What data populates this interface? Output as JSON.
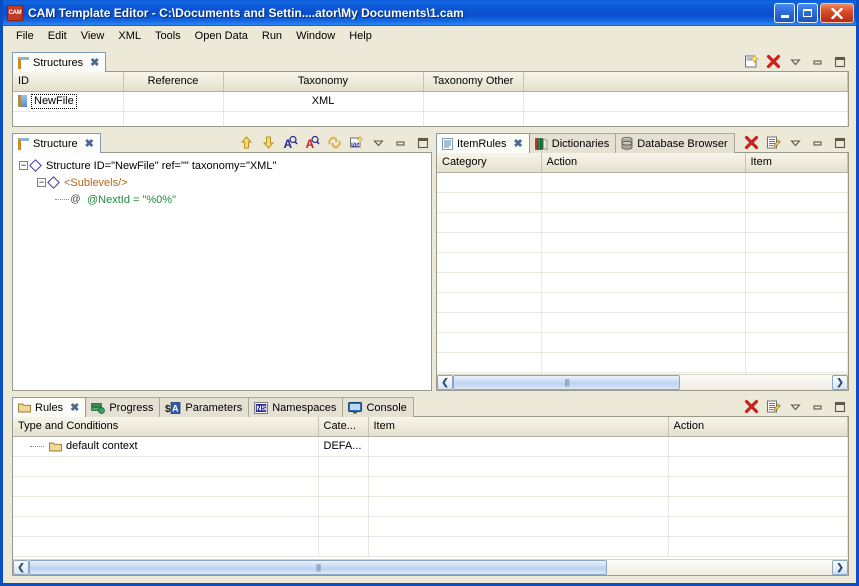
{
  "window": {
    "title": "CAM Template Editor - C:\\Documents and Settin....ator\\My Documents\\1.cam",
    "app_icon_label": "CAM",
    "minimize_label": "Minimize",
    "maximize_label": "Maximize",
    "close_label": "Close",
    "titlebar_color": "#0a50cf",
    "chrome_color": "#ece9d8"
  },
  "menubar": {
    "items": [
      {
        "label": "File"
      },
      {
        "label": "Edit"
      },
      {
        "label": "View"
      },
      {
        "label": "XML"
      },
      {
        "label": "Tools"
      },
      {
        "label": "Open Data"
      },
      {
        "label": "Run"
      },
      {
        "label": "Window"
      },
      {
        "label": "Help"
      }
    ]
  },
  "structures_view": {
    "tab": {
      "label": "Structures",
      "close_glyph": "✖",
      "icon": "structure-icon"
    },
    "toolbar": [
      {
        "name": "new-structure-icon",
        "title": "New"
      },
      {
        "name": "delete-icon",
        "title": "Delete"
      },
      {
        "name": "view-menu-icon",
        "title": "View Menu"
      },
      {
        "name": "minimize-icon",
        "title": "Minimize"
      },
      {
        "name": "maximize-icon",
        "title": "Maximize"
      }
    ],
    "columns": [
      "ID",
      "Reference",
      "Taxonomy",
      "Taxonomy Other",
      ""
    ],
    "rows": [
      {
        "id": "NewFile",
        "reference": "",
        "taxonomy": "XML",
        "taxonomy_other": "",
        "extra": ""
      },
      {
        "id": "",
        "reference": "",
        "taxonomy": "",
        "taxonomy_other": "",
        "extra": ""
      }
    ]
  },
  "structure_view": {
    "tab": {
      "label": "Structure",
      "close_glyph": "✖",
      "icon": "structure-icon"
    },
    "toolbar": [
      {
        "name": "move-up-icon",
        "title": "Move Up"
      },
      {
        "name": "move-down-icon",
        "title": "Move Down"
      },
      {
        "name": "find-add-icon",
        "title": "Add Annotation"
      },
      {
        "name": "find-remove-icon",
        "title": "Remove Annotation"
      },
      {
        "name": "link-icon",
        "title": "Link"
      },
      {
        "name": "namespace-icon",
        "title": "Namespaces"
      },
      {
        "name": "view-menu-icon",
        "title": "View Menu"
      },
      {
        "name": "minimize-icon",
        "title": "Minimize"
      },
      {
        "name": "maximize-icon",
        "title": "Maximize"
      }
    ],
    "tree": [
      {
        "depth": 0,
        "glyph": "diamond",
        "expander": "−",
        "text": "Structure ID=\"NewFile\" ref=\"\" taxonomy=\"XML\"",
        "color": "black"
      },
      {
        "depth": 1,
        "glyph": "diamond",
        "expander": "−",
        "text": "<Sublevels/>",
        "color": "orange"
      },
      {
        "depth": 2,
        "glyph": "at",
        "expander": "",
        "text": "@NextId = \"%0%\"",
        "color": "green"
      }
    ]
  },
  "itemrules_view": {
    "tabs": [
      {
        "label": "ItemRules",
        "icon": "document-icon",
        "active": true,
        "close_glyph": "✖"
      },
      {
        "label": "Dictionaries",
        "icon": "books-icon",
        "active": false
      },
      {
        "label": "Database Browser",
        "icon": "database-icon",
        "active": false
      }
    ],
    "toolbar": [
      {
        "name": "delete-icon",
        "title": "Delete"
      },
      {
        "name": "edit-icon",
        "title": "Edit"
      },
      {
        "name": "view-menu-icon",
        "title": "View Menu"
      },
      {
        "name": "minimize-icon",
        "title": "Minimize"
      },
      {
        "name": "maximize-icon",
        "title": "Maximize"
      }
    ],
    "columns": [
      "Category",
      "Action",
      "Item"
    ],
    "rows": [],
    "empty_row_count": 11,
    "hscroll": {
      "thumb_percent": 60,
      "left_glyph": "❮",
      "right_glyph": "❯",
      "grip": "||||"
    }
  },
  "rules_view": {
    "tabs": [
      {
        "label": "Rules",
        "icon": "folder-icon",
        "active": true,
        "close_glyph": "✖"
      },
      {
        "label": "Progress",
        "icon": "progress-icon",
        "active": false
      },
      {
        "label": "Parameters",
        "icon": "parameters-icon",
        "active": false
      },
      {
        "label": "Namespaces",
        "icon": "namespace-icon",
        "active": false
      },
      {
        "label": "Console",
        "icon": "console-icon",
        "active": false
      }
    ],
    "toolbar": [
      {
        "name": "delete-icon",
        "title": "Delete"
      },
      {
        "name": "edit-icon",
        "title": "Edit"
      },
      {
        "name": "view-menu-icon",
        "title": "View Menu"
      },
      {
        "name": "minimize-icon",
        "title": "Minimize"
      },
      {
        "name": "maximize-icon",
        "title": "Maximize"
      }
    ],
    "columns": [
      "Type and Conditions",
      "Cate...",
      "Item",
      "Action"
    ],
    "rows": [
      {
        "type_and_conditions": "default context",
        "category": "DEFA...",
        "item": "",
        "action": "",
        "icon": "folder-icon"
      },
      {
        "type_and_conditions": "",
        "category": "",
        "item": "",
        "action": "",
        "icon": ""
      },
      {
        "type_and_conditions": "",
        "category": "",
        "item": "",
        "action": "",
        "icon": ""
      },
      {
        "type_and_conditions": "",
        "category": "",
        "item": "",
        "action": "",
        "icon": ""
      },
      {
        "type_and_conditions": "",
        "category": "",
        "item": "",
        "action": "",
        "icon": ""
      },
      {
        "type_and_conditions": "",
        "category": "",
        "item": "",
        "action": "",
        "icon": ""
      }
    ],
    "hscroll": {
      "thumb_percent": 72,
      "left_glyph": "❮",
      "right_glyph": "❯",
      "grip": "||||"
    }
  }
}
